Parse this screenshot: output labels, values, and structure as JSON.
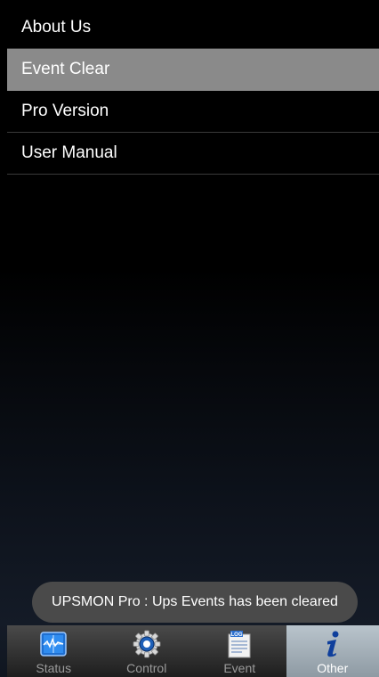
{
  "menu": {
    "items": [
      {
        "label": "About Us"
      },
      {
        "label": "Event Clear"
      },
      {
        "label": "Pro Version"
      },
      {
        "label": "User Manual"
      }
    ],
    "selected_index": 1
  },
  "toast": {
    "message": "UPSMON Pro : Ups Events has been cleared"
  },
  "tabs": [
    {
      "label": "Status",
      "icon": "monitor-icon"
    },
    {
      "label": "Control",
      "icon": "gear-icon"
    },
    {
      "label": "Event",
      "icon": "log-document-icon",
      "icon_text": "LOG"
    },
    {
      "label": "Other",
      "icon": "info-icon"
    }
  ],
  "active_tab": "Other",
  "colors": {
    "selected_row": "#8a8a8a",
    "toast_bg": "#4a4a4a",
    "active_tab": "#a9b4bc"
  }
}
